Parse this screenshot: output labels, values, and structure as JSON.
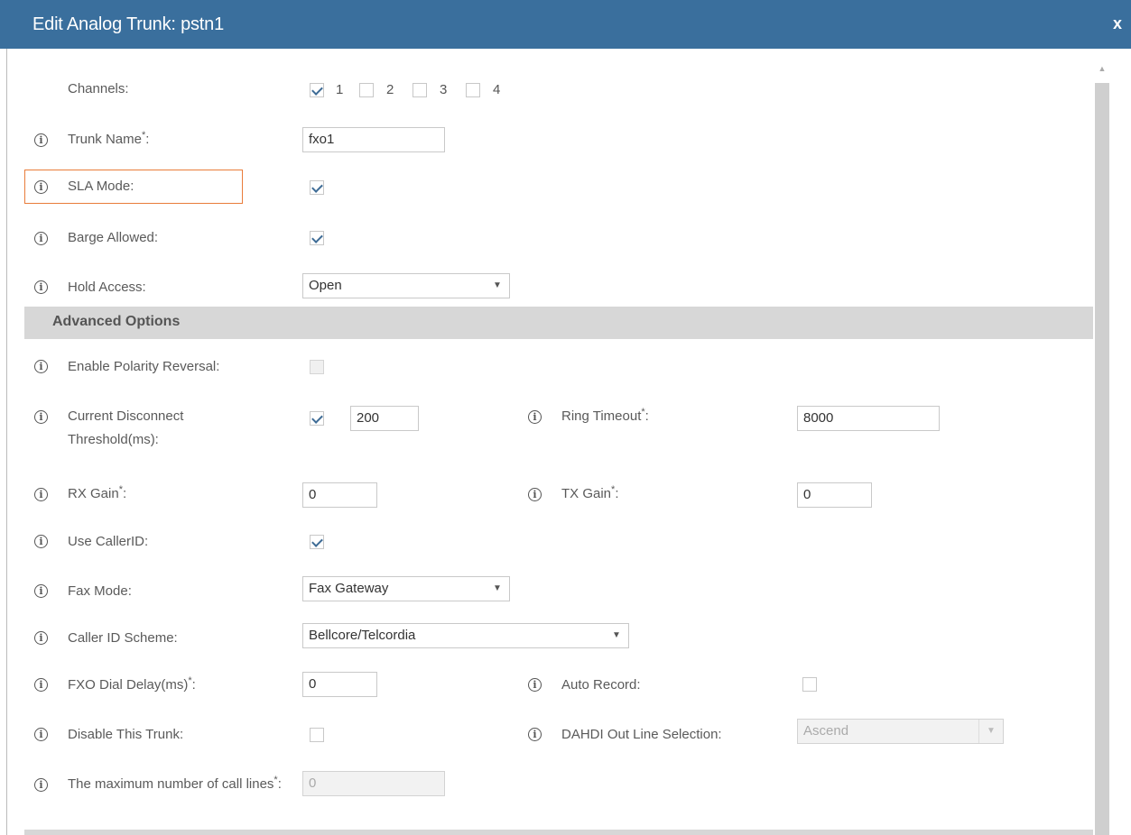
{
  "dialog": {
    "title": "Edit Analog Trunk: pstn1",
    "close_label": "x"
  },
  "channels": {
    "label": "Channels:",
    "items": [
      {
        "num": "1",
        "checked": true
      },
      {
        "num": "2",
        "checked": false
      },
      {
        "num": "3",
        "checked": false
      },
      {
        "num": "4",
        "checked": false
      }
    ]
  },
  "trunk_name": {
    "label": "Trunk Name",
    "value": "fxo1"
  },
  "sla_mode": {
    "label": "SLA Mode:",
    "checked": true
  },
  "barge_allowed": {
    "label": "Barge Allowed:",
    "checked": true
  },
  "hold_access": {
    "label": "Hold Access:",
    "value": "Open"
  },
  "advanced": {
    "title": "Advanced Options"
  },
  "polarity": {
    "label": "Enable Polarity Reversal:",
    "checked": false,
    "disabled": true
  },
  "current_disconnect": {
    "label": "Current Disconnect Threshold(ms):",
    "checked": true,
    "value": "200"
  },
  "ring_timeout": {
    "label": "Ring Timeout",
    "value": "8000"
  },
  "rx_gain": {
    "label": "RX Gain",
    "value": "0"
  },
  "tx_gain": {
    "label": "TX Gain",
    "value": "0"
  },
  "use_callerid": {
    "label": "Use CallerID:",
    "checked": true
  },
  "fax_mode": {
    "label": "Fax Mode:",
    "value": "Fax Gateway"
  },
  "callerid_scheme": {
    "label": "Caller ID Scheme:",
    "value": "Bellcore/Telcordia"
  },
  "fxo_dial_delay": {
    "label": "FXO Dial Delay(ms)",
    "value": "0"
  },
  "auto_record": {
    "label": "Auto Record:",
    "checked": false
  },
  "disable_trunk": {
    "label": "Disable This Trunk:",
    "checked": false
  },
  "dahdi_out": {
    "label": "DAHDI Out Line Selection:",
    "value": "Ascend"
  },
  "max_call_lines": {
    "label": "The maximum number of call lines",
    "value": "0"
  },
  "common": {
    "info_glyph": "i",
    "required_mark": "*",
    "colon": ":",
    "dropdown_arrow": "▼",
    "scroll_up": "▲"
  },
  "colors": {
    "titlebar": "#3a6f9d",
    "highlight": "#e97c3a",
    "section_bg": "#d7d7d7"
  }
}
